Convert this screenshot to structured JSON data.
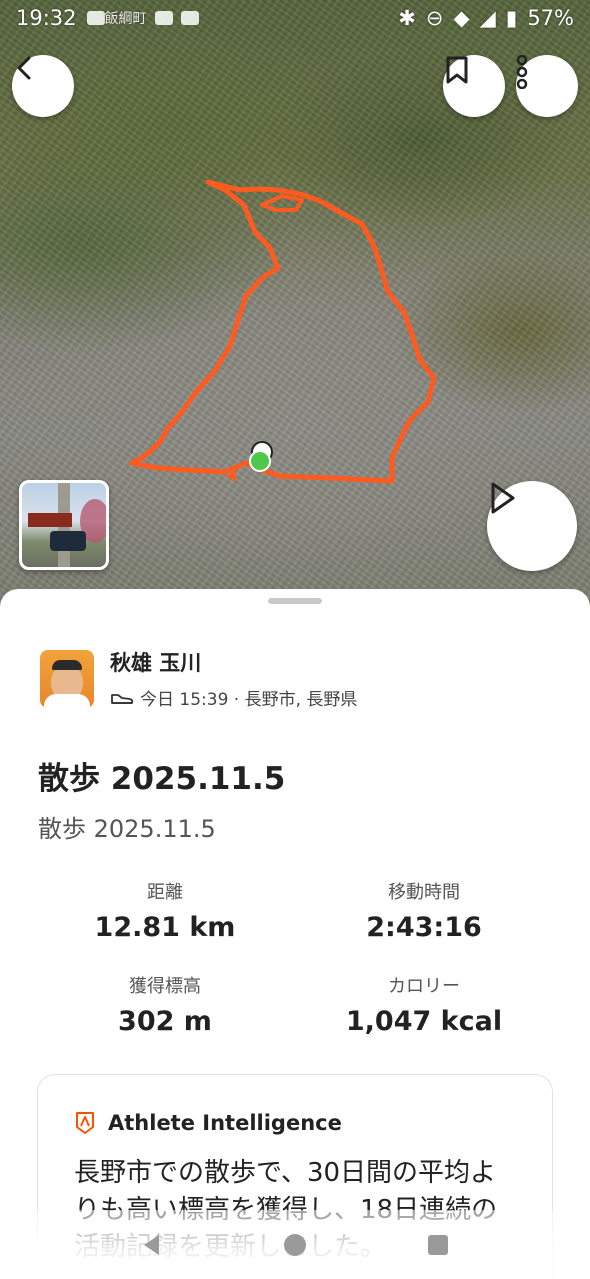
{
  "status_bar": {
    "time": "19:32",
    "app_label": "飯綱町",
    "battery": "57%"
  },
  "map": {
    "route_color": "#ff5a1f",
    "start_marker_color": "#4cc94a"
  },
  "athlete": {
    "name": "秋雄 玉川",
    "meta": "今日 15:39 · 長野市, 長野県",
    "activity_icon": "shoe-icon"
  },
  "activity": {
    "title": "散歩 2025.11.5",
    "subtitle": "散歩 2025.11.5"
  },
  "stats": [
    {
      "label": "距離",
      "value": "12.81 km"
    },
    {
      "label": "移動時間",
      "value": "2:43:16"
    },
    {
      "label": "獲得標高",
      "value": "302 m"
    },
    {
      "label": "カロリー",
      "value": "1,047 kcal"
    }
  ],
  "athlete_intelligence": {
    "title": "Athlete Intelligence",
    "text": "長野市での散歩で、30日間の平均よりも高い標高を獲得し、18日連続の活動記録を更新しました。",
    "accent_color": "#fc5200"
  },
  "colors": {
    "brand": "#fc5200"
  }
}
